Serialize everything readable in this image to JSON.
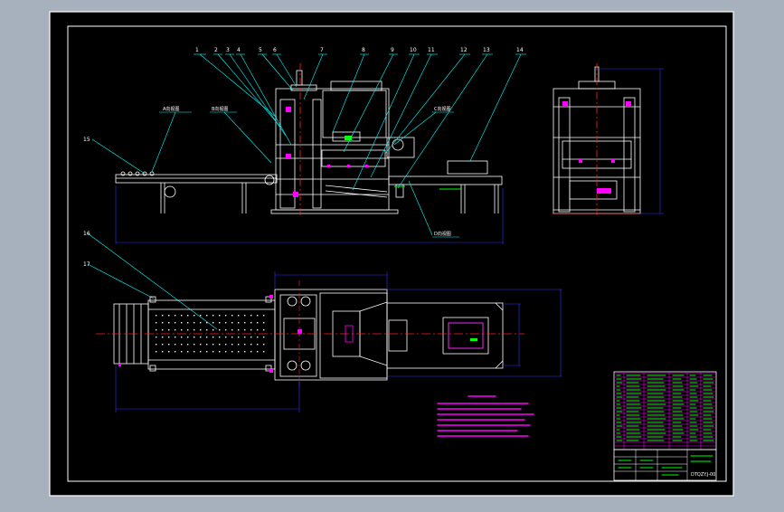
{
  "colors": {
    "backdrop": "#a7b0bd",
    "sheet": "#000000",
    "frame": "#ffffff",
    "leader": "#00ffff",
    "dimension": "#3333ff",
    "centerline": "#ff2020",
    "accent": "#ff00ff",
    "annotation": "#00ff00"
  },
  "callouts": [
    "1",
    "2",
    "3",
    "4",
    "5",
    "6",
    "7",
    "8",
    "9",
    "10",
    "11",
    "12",
    "13",
    "14",
    "15",
    "16",
    "17"
  ],
  "drawing": {
    "drawing_number": "DTQZY.J-00"
  }
}
